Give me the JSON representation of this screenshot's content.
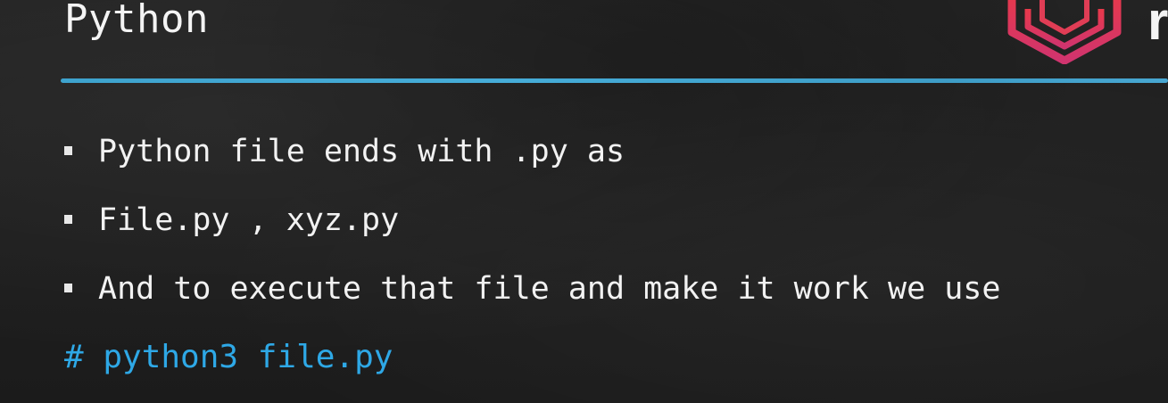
{
  "slide": {
    "title": "Python",
    "bullets": [
      "Python file ends with .py as",
      "File.py , xyz.py",
      "And to execute that file and make it work we use"
    ],
    "command": "# python3 file.py"
  },
  "logo": {
    "icon": "hexagon-logo-icon",
    "partial_letter": "r"
  },
  "colors": {
    "background": "#1e1e1e",
    "text": "#f2f2f2",
    "accent_rule": "#48b4e2",
    "command": "#2ea8e6",
    "logo_red": "#e8394a",
    "logo_pink": "#d0346e"
  }
}
